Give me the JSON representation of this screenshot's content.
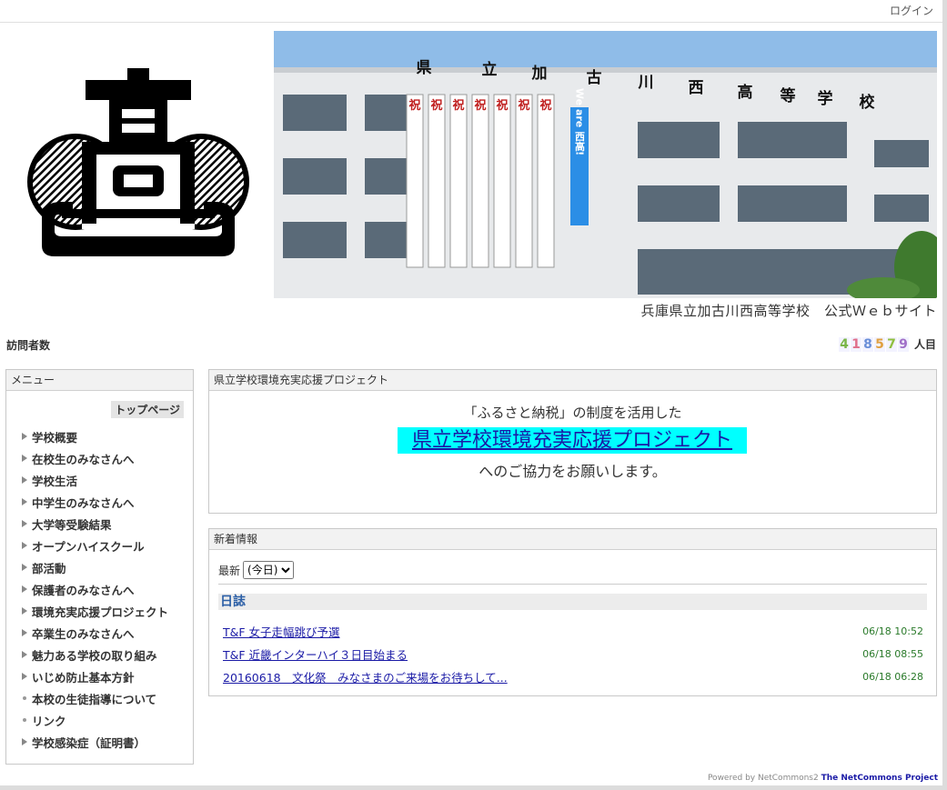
{
  "header": {
    "login_label": "ログイン"
  },
  "banner": {
    "school_name_chars": [
      "県",
      "立",
      "加",
      "古",
      "川",
      "西",
      "高",
      "等",
      "学",
      "校"
    ],
    "celebration_char": "祝",
    "flag_text": "We are 西高!",
    "caption": "兵庫県立加古川西高等学校　公式Ｗｅｂサイト"
  },
  "visitor": {
    "label": "訪問者数",
    "digits": [
      "4",
      "1",
      "8",
      "5",
      "7",
      "9"
    ],
    "digit_colors": [
      "#7ab648",
      "#e06f8b",
      "#6a8fd8",
      "#e0a040",
      "#8fbf3f",
      "#a070c8"
    ],
    "unit": "人目"
  },
  "menu": {
    "title": "メニュー",
    "home_label": "トップページ",
    "items": [
      {
        "label": "学校概要",
        "marker": "triangle"
      },
      {
        "label": "在校生のみなさんへ",
        "marker": "triangle"
      },
      {
        "label": "学校生活",
        "marker": "triangle"
      },
      {
        "label": "中学生のみなさんへ",
        "marker": "triangle"
      },
      {
        "label": "大学等受験結果",
        "marker": "triangle"
      },
      {
        "label": "オープンハイスクール",
        "marker": "triangle"
      },
      {
        "label": "部活動",
        "marker": "triangle"
      },
      {
        "label": "保護者のみなさんへ",
        "marker": "triangle"
      },
      {
        "label": "環境充実応援プロジェクト",
        "marker": "triangle"
      },
      {
        "label": "卒業生のみなさんへ",
        "marker": "triangle"
      },
      {
        "label": "魅力ある学校の取り組み",
        "marker": "triangle"
      },
      {
        "label": "いじめ防止基本方針",
        "marker": "triangle"
      },
      {
        "label": "本校の生徒指導について",
        "marker": "dot"
      },
      {
        "label": "リンク",
        "marker": "dot"
      },
      {
        "label": "学校感染症（証明書）",
        "marker": "triangle"
      }
    ]
  },
  "project": {
    "title": "県立学校環境充実応援プロジェクト",
    "line1": "「ふるさと納税」の制度を活用した",
    "link": "県立学校環境充実応援プロジェクト",
    "line2": "へのご協力をお願いします。"
  },
  "news": {
    "title": "新着情報",
    "filter_label": "最新",
    "filter_selected": "(今日)",
    "section": "日誌",
    "items": [
      {
        "title": "T&F 女子走幅跳び予選",
        "time": "06/18 10:52"
      },
      {
        "title": "T&F 近畿インターハイ３日目始まる",
        "time": "06/18 08:55"
      },
      {
        "title": "20160618　文化祭　みなさまのご来場をお待ちして...",
        "time": "06/18 06:28"
      }
    ]
  },
  "footer": {
    "powered": "Powered by NetCommons2",
    "project": "The NetCommons Project"
  }
}
